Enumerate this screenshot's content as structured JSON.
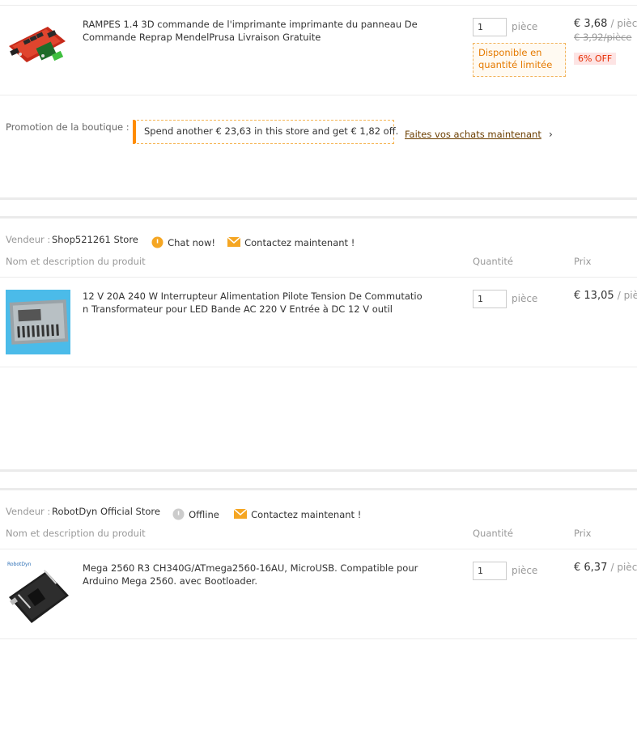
{
  "item1": {
    "title": "RAMPES 1.4 3D commande de l'imprimante imprimante du panneau De Commande Reprap MendelPrusa Livraison Gratuite",
    "qty": "1",
    "unit": "pièce",
    "limited": "Disponible en quantité limitée",
    "price": "€ 3,68",
    "per": "/ pièce",
    "old_price": "€ 3,92/pièce",
    "discount": "6% OFF"
  },
  "promotion": {
    "label": "Promotion de la boutique :",
    "message": "Spend another € 23,63 in this store and get € 1,82 off.",
    "link": "Faites vos achats maintenant",
    "chevron": "›"
  },
  "store1": {
    "seller_label": "Vendeur :",
    "seller_name": "Shop521261 Store",
    "chat": "Chat now!",
    "contact": "Contactez maintenant !",
    "col_name": "Nom et description du produit",
    "col_qty": "Quantité",
    "col_price": "Prix",
    "item": {
      "title": "12 V 20A 240 W Interrupteur Alimentation Pilote Tension De Commutation Transformateur pour LED Bande AC 220 V Entrée à DC 12 V outil",
      "qty": "1",
      "unit": "pièce",
      "price": "€ 13,05",
      "per": "/ pièce"
    }
  },
  "store2": {
    "seller_label": "Vendeur :",
    "seller_name": "RobotDyn Official Store",
    "status": "Offline",
    "contact": "Contactez maintenant !",
    "col_name": "Nom et description du produit",
    "col_qty": "Quantité",
    "col_price": "Prix",
    "item": {
      "title": "Mega 2560 R3 CH340G/ATmega2560-16AU, MicroUSB. Compatible pour Arduino Mega 2560. avec Bootloader.",
      "qty": "1",
      "unit": "pièce",
      "price": "€ 6,37",
      "per": "/ pièce",
      "image_logo": "RobotDyn"
    }
  },
  "colors": {
    "accent": "#ff8c00",
    "discount_red": "#e62e04",
    "limited_orange": "#e57a00",
    "chat_icon": "#f5a623",
    "offline_icon": "#cccccc"
  }
}
